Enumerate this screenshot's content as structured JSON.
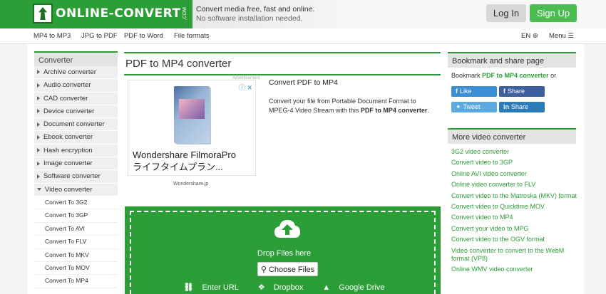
{
  "header": {
    "logo_text": "ONLINE-CONVERT",
    "logo_com": ".COM",
    "tagline_1": "Convert media free, fast and online.",
    "tagline_2": "No software installation needed.",
    "login_label": "Log In",
    "signup_label": "Sign Up"
  },
  "nav": {
    "items": [
      "MP4 to MP3",
      "JPG to PDF",
      "PDF to Word",
      "File formats"
    ],
    "lang": "EN",
    "menu": "Menu"
  },
  "sidebar": {
    "heading": "Converter",
    "items": [
      "Archive converter",
      "Audio converter",
      "CAD converter",
      "Device converter",
      "Document converter",
      "Ebook converter",
      "Hash encryption",
      "Image converter",
      "Software converter",
      "Video converter"
    ],
    "subitems": [
      "Convert To 3G2",
      "Convert To 3GP",
      "Convert To AVI",
      "Convert To FLV",
      "Convert To MKV",
      "Convert To MOV",
      "Convert To MP4"
    ]
  },
  "main": {
    "title": "PDF to MP4 converter",
    "ad": {
      "label": "Advertisement",
      "title_line1": "Wondershare FilmoraPro",
      "title_line2": "ライフタイムプラン...",
      "source": "Wondershare.jp"
    },
    "desc_title": "Convert PDF to MP4",
    "desc_text": "Convert your file from Portable Document Format to MPEG-4 Video Stream with this",
    "desc_bold": "PDF to MP4 converter",
    "desc_end": ".",
    "drop": {
      "label": "Drop Files here",
      "choose": "Choose Files",
      "enter_url": "Enter URL",
      "dropbox": "Dropbox",
      "gdrive": "Google Drive"
    }
  },
  "right": {
    "bookmark_heading": "Bookmark and share page",
    "bookmark_prefix": "Bookmark",
    "bookmark_link": "PDF to MP4 converter",
    "bookmark_suffix": "or",
    "fb_like": "Like",
    "fb_share": "Share",
    "tweet": "Tweet",
    "li_share": "Share",
    "more_heading": "More video converter",
    "links": [
      "3G2 video converter",
      "Convert video to 3GP",
      "Online AVI video converter",
      "Online video converter to FLV",
      "Convert video to the Matroska (MKV) format",
      "Convert video to Quicktime MOV",
      "Convert video to MP4",
      "Convert your video to MPG",
      "Convert video to the OGV format",
      "Video converter to convert to the WebM format (VP8)",
      "Online WMV video converter"
    ]
  },
  "colors": {
    "brand_green": "#2c9e37",
    "signup_green": "#4cbb52",
    "facebook": "#3e5f9e",
    "twitter": "#5aa9e2"
  }
}
